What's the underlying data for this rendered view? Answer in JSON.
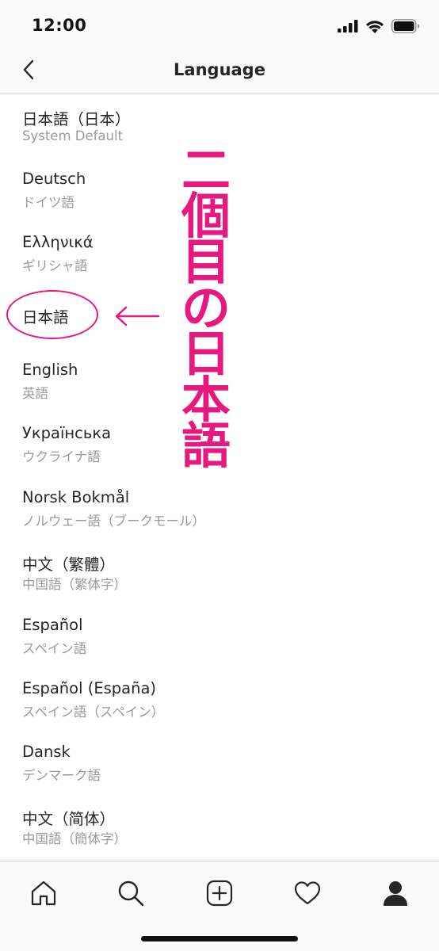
{
  "status_bar": {
    "time": "12:00"
  },
  "nav": {
    "title": "Language"
  },
  "languages": [
    {
      "name": "日本語（日本）",
      "sub": "System Default"
    },
    {
      "name": "Deutsch",
      "sub": "ドイツ語"
    },
    {
      "name": "Ελληνικά",
      "sub": "ギリシャ語"
    },
    {
      "name": "日本語",
      "sub": ""
    },
    {
      "name": "English",
      "sub": "英語"
    },
    {
      "name": "Українська",
      "sub": "ウクライナ語"
    },
    {
      "name": "Norsk Bokmål",
      "sub": "ノルウェー語（ブークモール）"
    },
    {
      "name": "中文（繁體）",
      "sub": "中国語（繁体字）"
    },
    {
      "name": "Español",
      "sub": "スペイン語"
    },
    {
      "name": "Español (España)",
      "sub": "スペイン語（スペイン）"
    },
    {
      "name": "Dansk",
      "sub": "デンマーク語"
    },
    {
      "name": "中文（简体）",
      "sub": "中国語（簡体字）"
    }
  ],
  "annotation": {
    "arrow": "←",
    "chars": [
      "二",
      "個",
      "目",
      "の",
      "日",
      "本",
      "語"
    ],
    "color": "#e6197e"
  },
  "tab_bar": {
    "icons": [
      "home-icon",
      "search-icon",
      "new-post-icon",
      "activity-heart-icon",
      "profile-icon"
    ]
  }
}
